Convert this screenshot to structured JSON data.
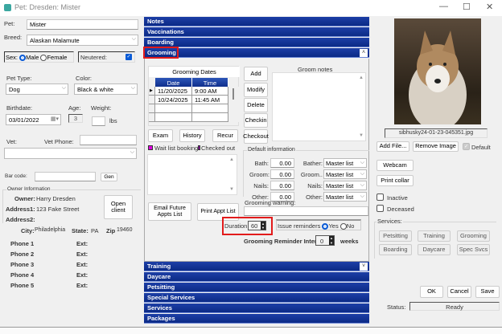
{
  "window": {
    "title": "Pet: Dresden: Mister"
  },
  "pet": {
    "pet_label": "Pet:",
    "pet_name": "Mister",
    "breed_label": "Breed:",
    "breed": "Alaskan Malamute",
    "sex_label": "Sex:",
    "sex_options": [
      "Male",
      "Female"
    ],
    "sex_selected": "Male",
    "neutered_label": "Neutered:",
    "neutered": true,
    "type_label": "Pet Type:",
    "type": "Dog",
    "color_label": "Color:",
    "color": "Black & white",
    "birthdate_label": "Birthdate:",
    "birthdate": "03/01/2022",
    "age_label": "Age:",
    "age": "3",
    "weight_label": "Weight:",
    "weight": "",
    "weight_unit": "lbs",
    "vet_label": "Vet:",
    "vet_phone_label": "Vet Phone:",
    "vet_phone": "",
    "vet": "",
    "barcode_label": "Bar code:",
    "barcode": "",
    "gen_button": "Gen"
  },
  "owner": {
    "group_label": "Owner Information",
    "owner_label": "Owner:",
    "owner": "Harry Dresden",
    "address1_label": "Address1:",
    "address1": "123 Fake Street",
    "address2_label": "Address2:",
    "address2": "",
    "open_client": "Open client",
    "city_label": "City:",
    "city": "Philadelphia",
    "state_label": "State:",
    "state": "PA",
    "zip_label": "Zip",
    "zip": "19460",
    "phones": [
      {
        "label": "Phone 1",
        "ext": "Ext:"
      },
      {
        "label": "Phone 2",
        "ext": "Ext:"
      },
      {
        "label": "Phone 3",
        "ext": "Ext:"
      },
      {
        "label": "Phone 4",
        "ext": "Ext:"
      },
      {
        "label": "Phone 5",
        "ext": "Ext:"
      }
    ]
  },
  "sections_top": [
    "Notes",
    "Vaccinations",
    "Boarding",
    "Grooming"
  ],
  "sections_bottom": [
    "Training",
    "Daycare",
    "Petsitting",
    "Special Services",
    "Services",
    "Packages"
  ],
  "grooming": {
    "dates_title": "Grooming Dates",
    "columns": [
      "Date",
      "Time"
    ],
    "rows": [
      {
        "date": "11/20/2025",
        "time": "9:00 AM"
      },
      {
        "date": "10/24/2025",
        "time": "11:45 AM"
      }
    ],
    "buttons": [
      "Add",
      "Modify",
      "Delete",
      "Checkin",
      "Checkout"
    ],
    "notes_label": "Groom notes",
    "exam": "Exam",
    "history": "History",
    "recur": "Recur",
    "legend_waitlist": "Wait list booking",
    "legend_checked": "Checked out",
    "default_label": "Default information",
    "defaults": [
      {
        "label": "Bath:",
        "value": "0.00",
        "staff_label": "Bather:",
        "staff": "Master list"
      },
      {
        "label": "Groom:",
        "value": "0.00",
        "staff_label": "Groom..",
        "staff": "Master list"
      },
      {
        "label": "Nails:",
        "value": "0.00",
        "staff_label": "Nails:",
        "staff": "Master list"
      },
      {
        "label": "Other:",
        "value": "0.00",
        "staff_label": "Other:",
        "staff": "Master list"
      }
    ],
    "warning_label": "Grooming warning:",
    "warning": "",
    "email_future": "Email Future Appts List",
    "print_appt": "Print Appt List",
    "duration_label": "Duration:",
    "duration": "60",
    "reminders_label": "Issue reminders",
    "reminder_options": [
      "Yes",
      "No"
    ],
    "reminder_selected": "Yes",
    "interval_label": "Grooming Reminder Interval:",
    "interval": "0",
    "interval_unit": "weeks"
  },
  "image": {
    "filename": "sibhusky24-01-23-045351.jpg",
    "add_file": "Add File...",
    "remove": "Remove Image",
    "default_label": "Default"
  },
  "right": {
    "webcam": "Webcam",
    "print_collar": "Print collar",
    "inactive": "Inactive",
    "deceased": "Deceased",
    "services_label": "Services:",
    "services": [
      "Petsitting",
      "Training",
      "Grooming",
      "Boarding",
      "Daycare",
      "Spec Svcs"
    ],
    "ok": "OK",
    "cancel": "Cancel",
    "save": "Save",
    "status_label": "Status:",
    "status": "Ready"
  }
}
